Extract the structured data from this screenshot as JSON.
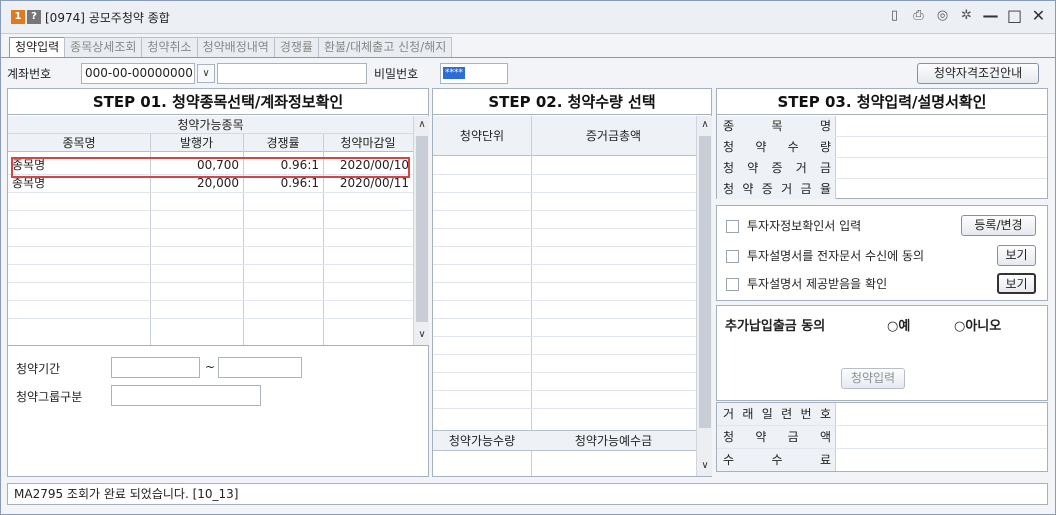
{
  "window": {
    "badge_one": "1",
    "badge_q": "?",
    "title": "[0974] 공모주청약 종합",
    "tools": [
      "▯",
      "⎙",
      "◎",
      "✲",
      "—",
      "□",
      "✕"
    ]
  },
  "tabs": [
    "청약입력",
    "종목상세조회",
    "청약취소",
    "청약배정내역",
    "경쟁률",
    "환불/대체출고 신청/해지"
  ],
  "account": {
    "label": "계좌번호",
    "value": "000-00-00000000",
    "combo_arrow": "∨",
    "name_value": "",
    "password_label": "비밀번호",
    "password_mask": "****",
    "guide_button": "청약자격조건안내"
  },
  "step1": {
    "title": "STEP 01. 청약종목선택/계좌정보확인",
    "group_header": "청약가능종목",
    "columns": [
      "종목명",
      "발행가",
      "경쟁률",
      "청약마감일"
    ],
    "rows": [
      [
        "종목명",
        "00,700",
        "0.96:1",
        "2020/00/10"
      ],
      [
        "종목명",
        "20,000",
        "0.96:1",
        "2020/00/11"
      ]
    ],
    "period_label": "청약기간",
    "period_sep": "~",
    "group_label": "청약그룹구분"
  },
  "step2": {
    "title": "STEP 02. 청약수량 선택",
    "columns": [
      "청약단위",
      "증거금총액"
    ],
    "footer_columns": [
      "청약가능수량",
      "청약가능예수금"
    ]
  },
  "step3": {
    "title": "STEP 03. 청약입력/설명서확인",
    "info_labels": [
      "종 목 명",
      "청 약 수 량",
      "청 약 증 거 금",
      "청 약 증 거 금 율"
    ],
    "checks": [
      {
        "label": "투자자정보확인서 입력",
        "button": "등록/변경"
      },
      {
        "label": "투자설명서를 전자문서 수신에 동의",
        "button": "보기"
      },
      {
        "label": "투자설명서 제공받음을 확인",
        "button": "보기"
      }
    ],
    "consent_label": "추가납입출금 동의",
    "radio_yes": "예",
    "radio_no": "아니오",
    "submit_button": "청약입력",
    "result_labels": [
      "거 래 일 련 번 호",
      "청 약 금 액",
      "수 수 료"
    ]
  },
  "scroll": {
    "up": "∧",
    "down": "∨"
  },
  "status": "MA2795 조회가 완료 되었습니다. [10_13]",
  "colors": {
    "highlight": "#d64545",
    "accent": "#2b6cd6",
    "badge": "#e07a1f"
  }
}
